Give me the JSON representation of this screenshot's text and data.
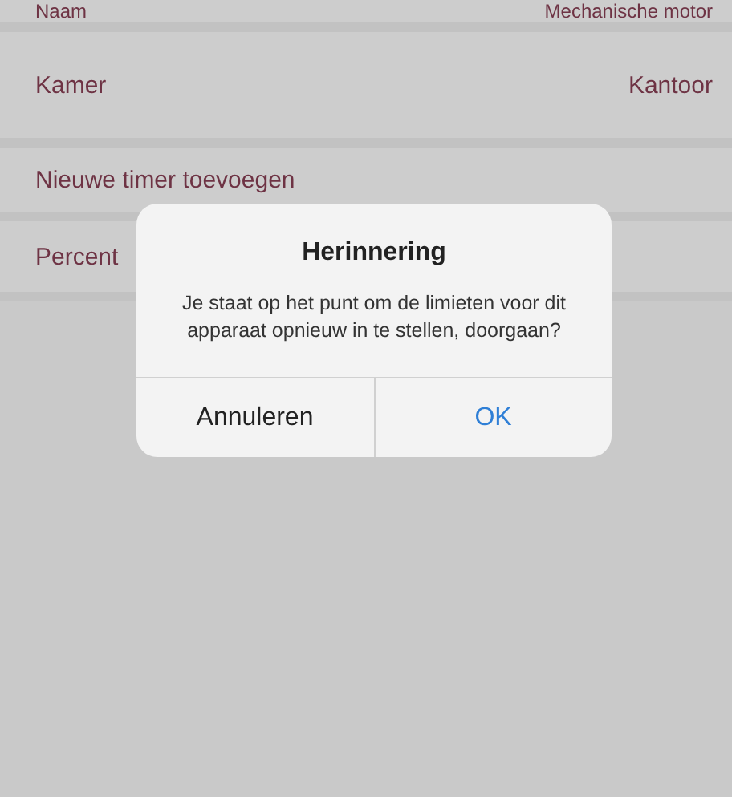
{
  "settings": [
    {
      "label": "Naam",
      "value": "Mechanische motor"
    },
    {
      "label": "Kamer",
      "value": "Kantoor"
    },
    {
      "label": "Nieuwe timer toevoegen"
    },
    {
      "label": "Percent"
    }
  ],
  "alert": {
    "title": "Herinnering",
    "message": "Je staat op het punt om de limieten voor dit apparaat opnieuw in te stellen, doorgaan?",
    "buttons": [
      {
        "label": "Annuleren",
        "kind": "cancel"
      },
      {
        "label": "OK",
        "kind": "default"
      }
    ]
  }
}
